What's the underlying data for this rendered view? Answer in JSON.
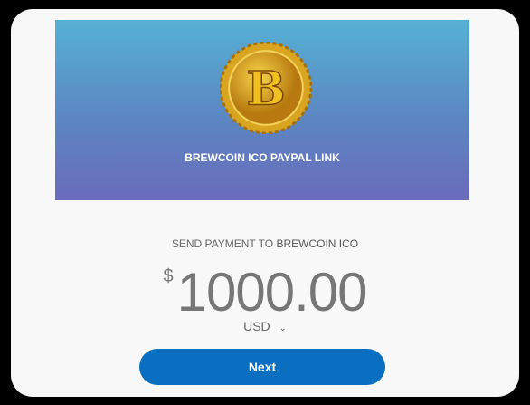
{
  "banner": {
    "title": "BREWCOIN ICO PAYPAL LINK",
    "logo_letter": "B"
  },
  "payment": {
    "label": "SEND PAYMENT TO",
    "recipient": "BREWCOIN ICO",
    "currency_symbol": "$",
    "amount": "1000.00",
    "currency": "USD"
  },
  "actions": {
    "next_label": "Next"
  },
  "colors": {
    "button": "#0a6fc1"
  }
}
